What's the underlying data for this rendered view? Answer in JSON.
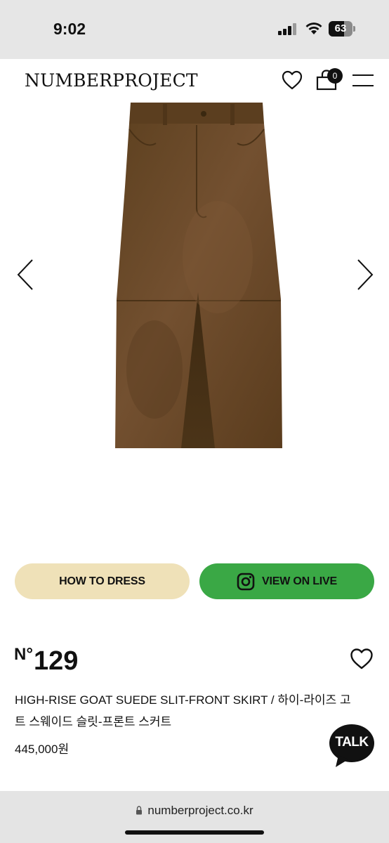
{
  "status_bar": {
    "time": "9:02",
    "battery": "63"
  },
  "header": {
    "brand": "NUMBERPROJECT",
    "cart_count": "0"
  },
  "gallery": {
    "prev_icon": "chevron-left-icon",
    "next_icon": "chevron-right-icon"
  },
  "buttons": {
    "how_to_dress": "HOW TO DRESS",
    "view_on_live": "VIEW ON LIVE"
  },
  "product": {
    "number_prefix": "N°",
    "number": "129",
    "name": "HIGH-RISE GOAT SUEDE SLIT-FRONT SKIRT / 하이-라이즈 고트 스웨이드 슬릿-프론트 스커트",
    "price": "445,000원"
  },
  "chat": {
    "label": "TALK"
  },
  "browser": {
    "url": "numberproject.co.kr"
  },
  "colors": {
    "how_to_dress_bg": "#efe1b8",
    "view_on_live_bg": "#3aa845",
    "skirt": "#6b4a26"
  }
}
